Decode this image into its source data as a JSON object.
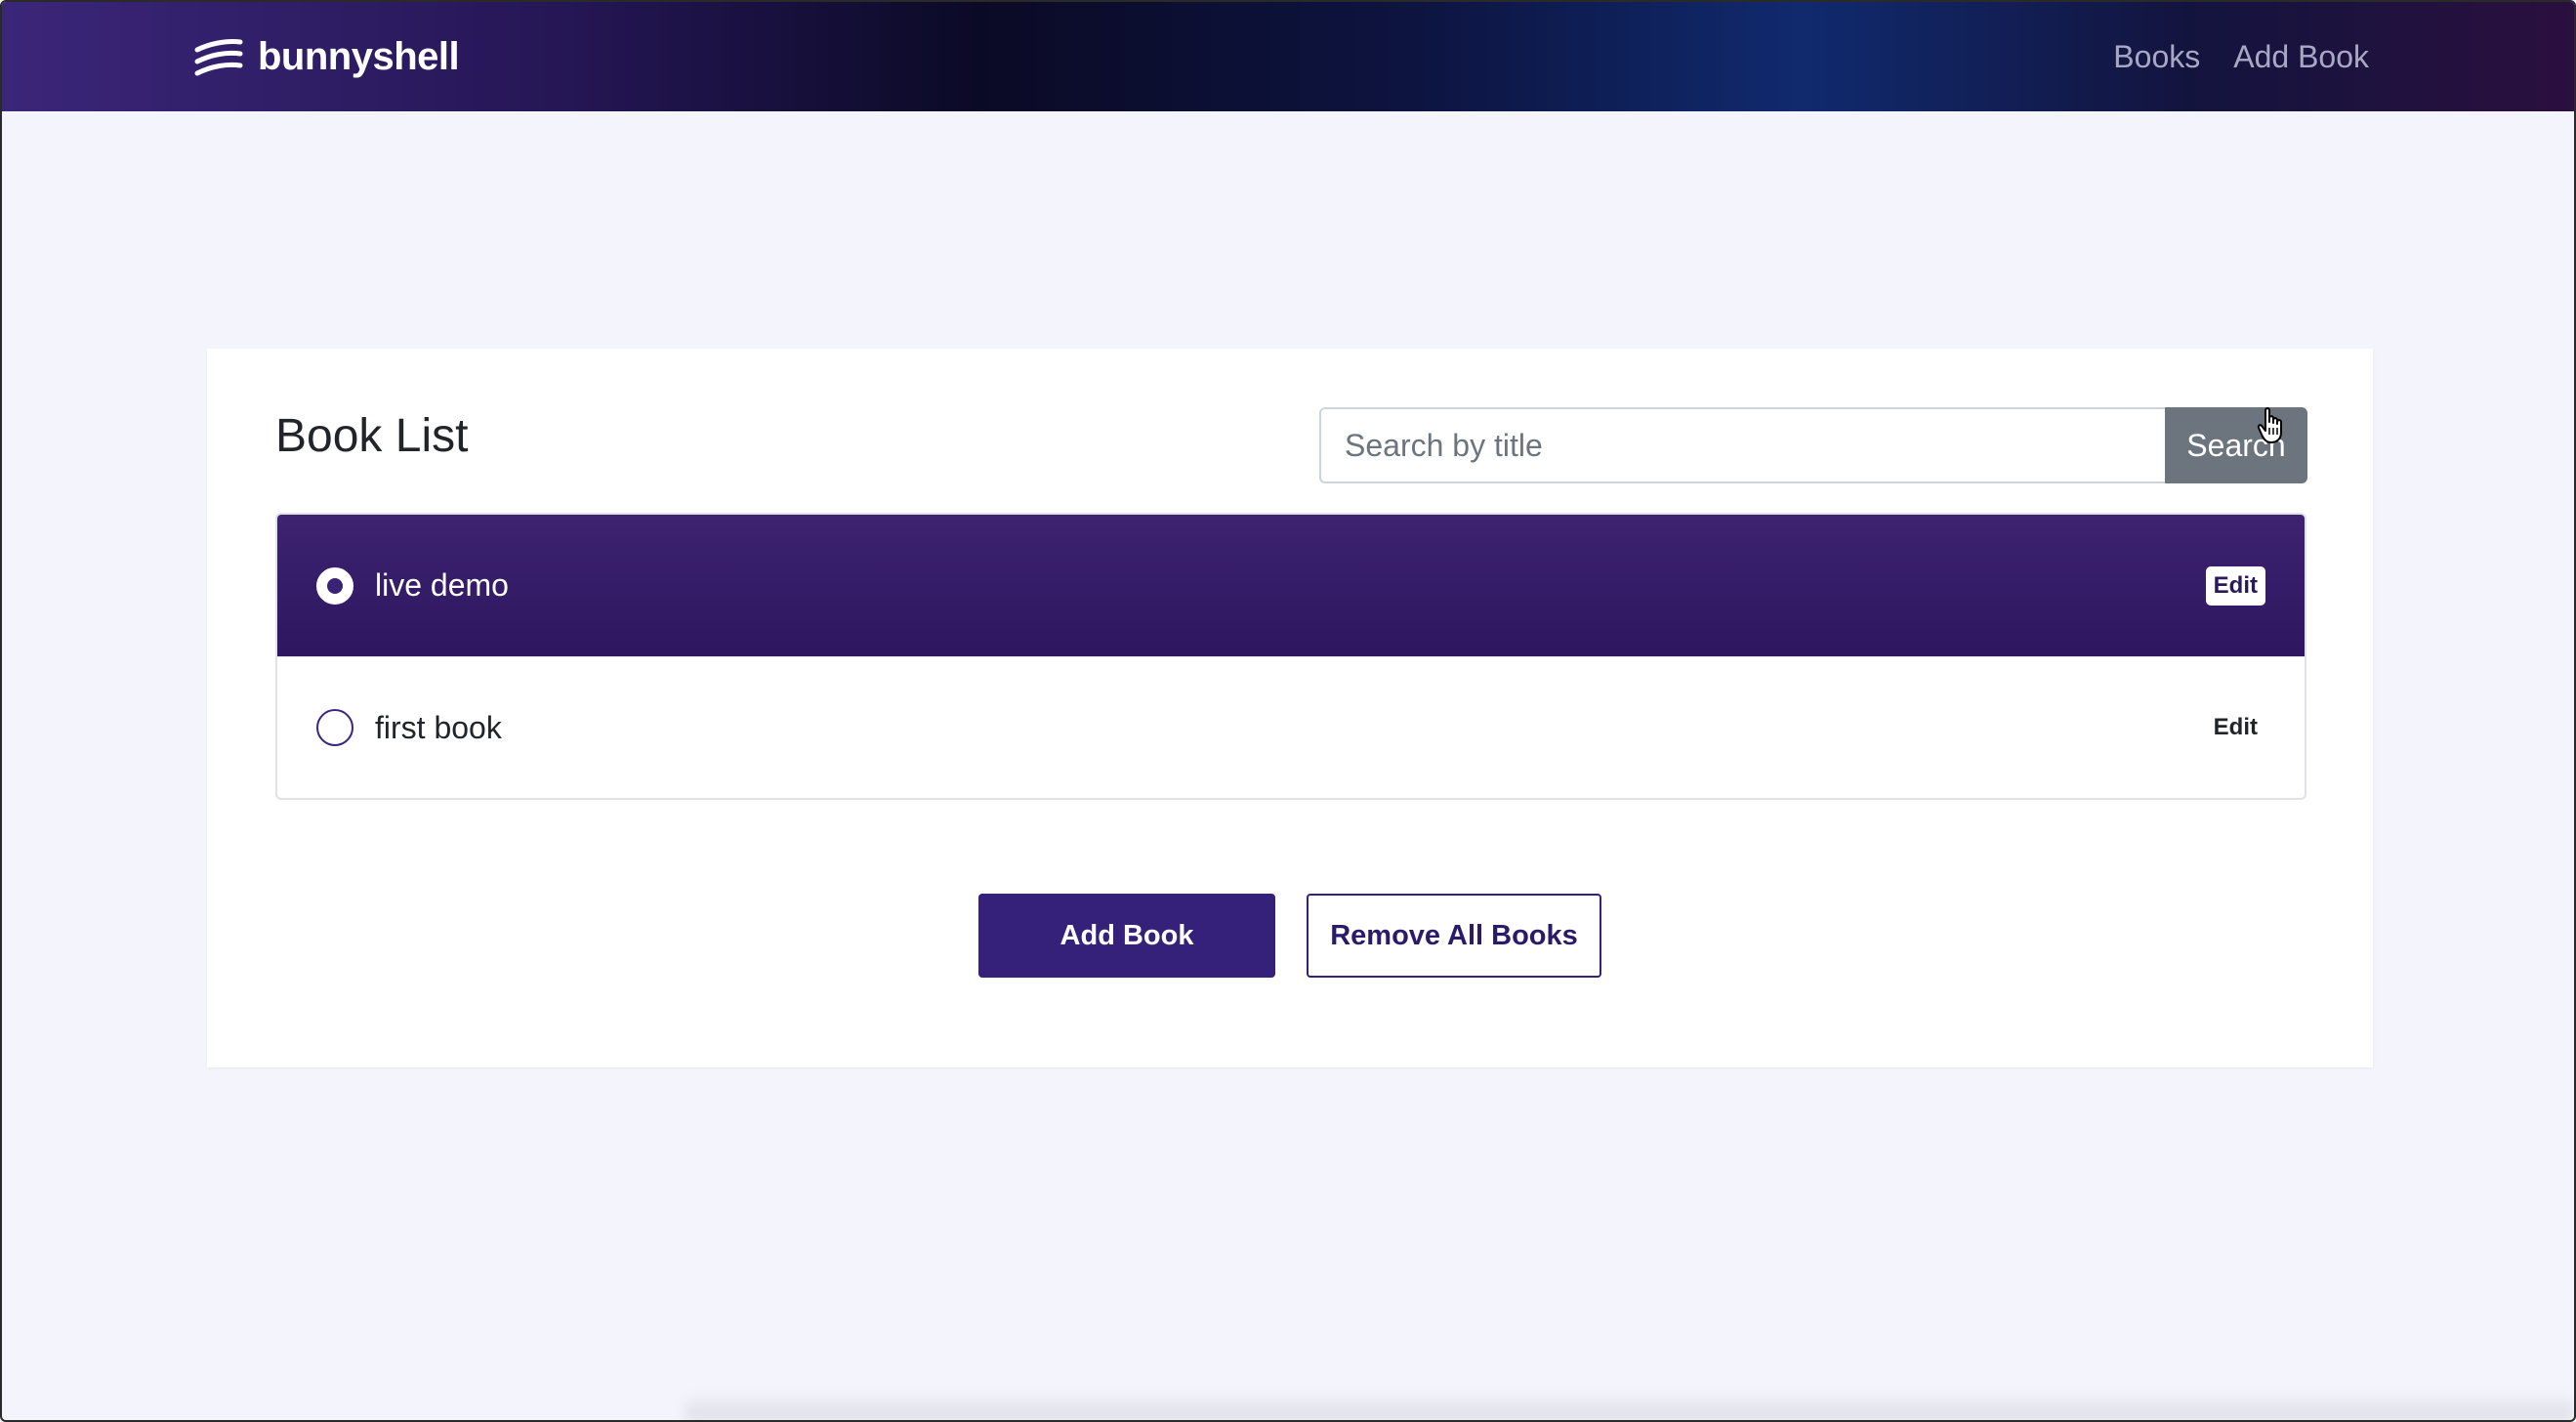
{
  "navbar": {
    "brand_text": "bunnyshell",
    "links": [
      {
        "label": "Books"
      },
      {
        "label": "Add Book"
      }
    ]
  },
  "book_list": {
    "title": "Book List",
    "search": {
      "placeholder": "Search by title",
      "value": "",
      "button_label": "Search"
    },
    "items": [
      {
        "title": "live demo",
        "selected": true,
        "edit_label": "Edit"
      },
      {
        "title": "first book",
        "selected": false,
        "edit_label": "Edit"
      }
    ]
  },
  "actions": {
    "add_label": "Add Book",
    "remove_all_label": "Remove All Books"
  },
  "colors": {
    "primary": "#35207a",
    "active_row": "#3a2275",
    "search_button": "#6c757d",
    "page_background": "#f3f4fc"
  }
}
